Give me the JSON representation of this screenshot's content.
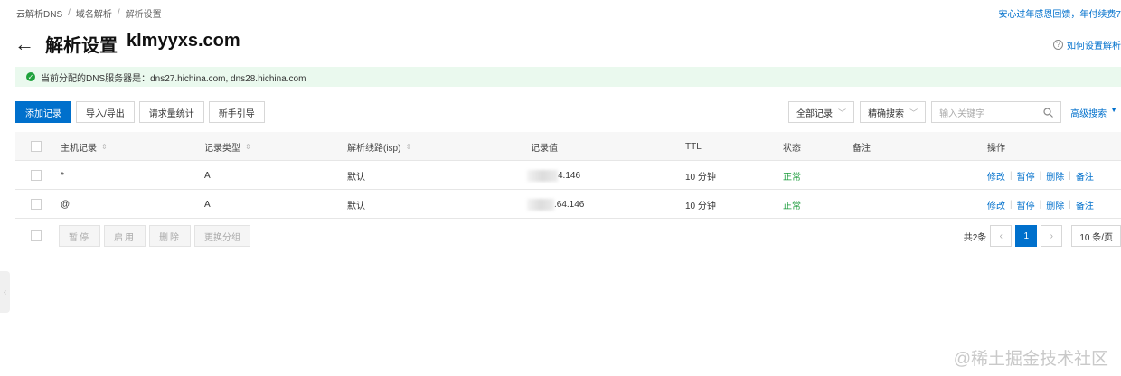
{
  "breadcrumb": [
    "云解析DNS",
    "域名解析",
    "解析设置"
  ],
  "promo_text": "安心过年感恩回馈，年付续费7",
  "page": {
    "title_prefix": "解析设置",
    "domain": "klmyyxs.com",
    "back_icon": "←"
  },
  "help_link": "如何设置解析",
  "notice": "当前分配的DNS服务器是：dns27.hichina.com, dns28.hichina.com",
  "toolbar": {
    "add": "添加记录",
    "import": "导入/导出",
    "stats": "请求量统计",
    "guide": "新手引导"
  },
  "filters": {
    "scope": "全部记录",
    "mode": "精确搜索",
    "search_placeholder": "输入关键字",
    "advanced": "高级搜索"
  },
  "columns": [
    "主机记录",
    "记录类型",
    "解析线路(isp)",
    "记录值",
    "TTL",
    "状态",
    "备注",
    "操作"
  ],
  "rows": [
    {
      "host": "*",
      "type": "A",
      "line": "默认",
      "value": "4.146",
      "ttl": "10 分钟",
      "status": "正常",
      "remark": ""
    },
    {
      "host": "@",
      "type": "A",
      "line": "默认",
      "value": ".64.146",
      "ttl": "10 分钟",
      "status": "正常",
      "remark": ""
    }
  ],
  "actions": [
    "修改",
    "暂停",
    "删除",
    "备注"
  ],
  "bulk": [
    "暂停",
    "启用",
    "删除",
    "更换分组"
  ],
  "pager": {
    "total": "共2条",
    "current": "1",
    "page_size": "10 条/页"
  },
  "watermark": "@稀土掘金技术社区"
}
